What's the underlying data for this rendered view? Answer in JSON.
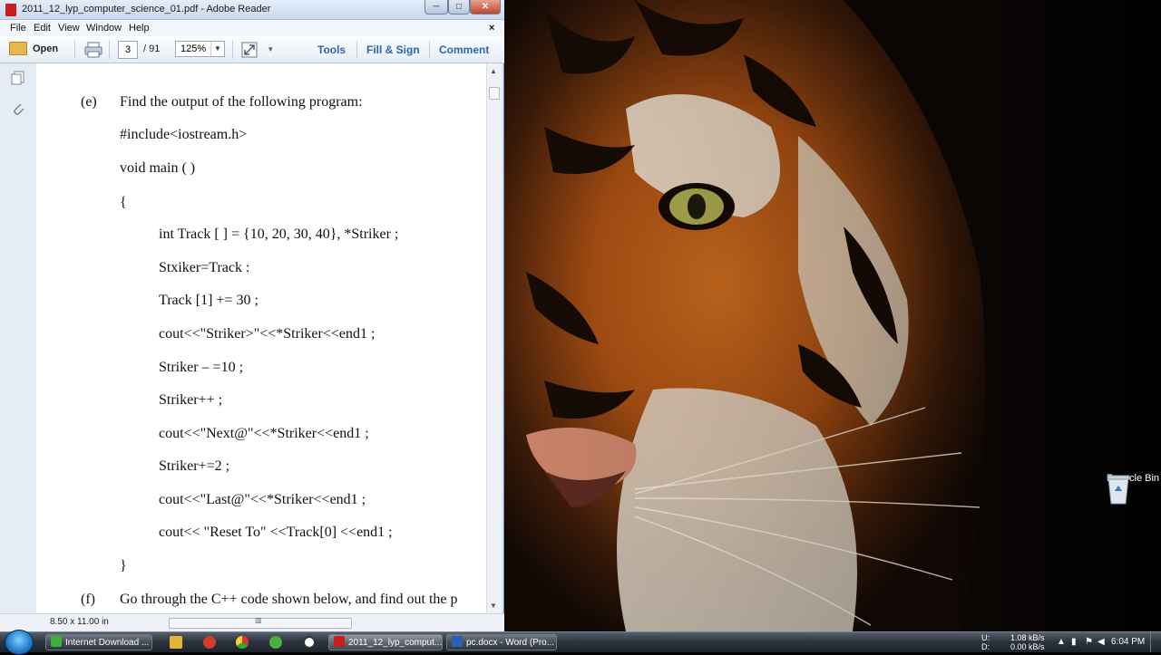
{
  "window": {
    "title": "2011_12_lyp_computer_science_01.pdf - Adobe Reader",
    "minimize_glyph": "─",
    "maximize_glyph": "□",
    "close_glyph": "✕"
  },
  "menu": {
    "items": [
      "File",
      "Edit",
      "View",
      "Window",
      "Help"
    ],
    "close_glyph": "×"
  },
  "toolbar": {
    "open_label": "Open",
    "page_current": "3",
    "page_total": "/ 91",
    "zoom": "125%",
    "tools_label": "Tools",
    "fill_sign_label": "Fill & Sign",
    "comment_label": "Comment"
  },
  "document": {
    "lines": [
      {
        "label": "(e)",
        "text": "Find the output of the following program:"
      },
      {
        "text": "#include<iostream.h>"
      },
      {
        "text": "void main ( )"
      },
      {
        "text": "{"
      },
      {
        "text": "int Track [ ] = {10, 20, 30, 40}, *Striker ;"
      },
      {
        "text": "Stxiker=Track :"
      },
      {
        "text": "Track [1] += 30 ;"
      },
      {
        "text": "cout<<\"Striker>\"<<*Striker<<end1 ;"
      },
      {
        "text": "Striker – =10 ;"
      },
      {
        "text": "Striker++ ;"
      },
      {
        "text": "cout<<\"Next@\"<<*Striker<<end1 ;"
      },
      {
        "text": "Striker+=2 ;"
      },
      {
        "text": "cout<<\"Last@\"<<*Striker<<end1 ;"
      },
      {
        "text": "cout<< \"Reset To\" <<Track[0] <<end1 ;"
      },
      {
        "text": "}"
      },
      {
        "label": "(f)",
        "text": "Go through the C++ code shown below, and find out the p"
      }
    ]
  },
  "status": {
    "page_size": "8.50 x 11.00 in"
  },
  "desktop": {
    "recycle_bin_label": "Recycle Bin"
  },
  "taskbar": {
    "tasks": [
      {
        "label": "Internet Download ...",
        "color": "#3fae3f"
      },
      {
        "label": "2011_12_lyp_comput...",
        "color": "#c81d1d"
      },
      {
        "label": "pc.docx - Word (Pro...",
        "color": "#2b5fb5"
      }
    ],
    "tray": {
      "upload_label": "U:",
      "download_label": "D:",
      "upload_rate": "1.08 kB/s",
      "download_rate": "0.00 kB/s",
      "clock": "6:04 PM"
    }
  }
}
